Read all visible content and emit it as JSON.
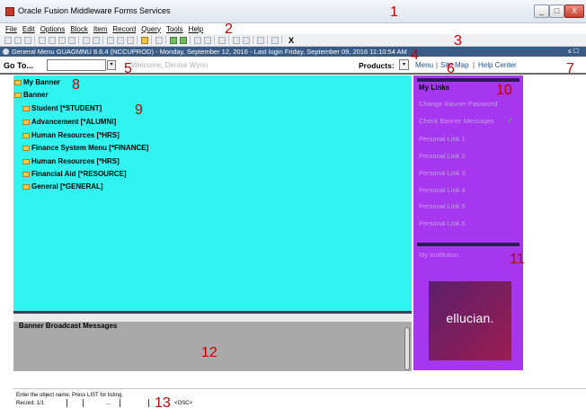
{
  "window": {
    "title": "Oracle Fusion Middleware Forms Services",
    "min": "_",
    "max": "□",
    "close": "X"
  },
  "menubar": [
    "File",
    "Edit",
    "Options",
    "Block",
    "Item",
    "Record",
    "Query",
    "Tools",
    "Help"
  ],
  "toolbar": {
    "exit_label": "X"
  },
  "form_title": "General Menu  GUAGMNU  8.6.4  (NCCUPROD) - Monday, September 12, 2016 - Last login Friday, September 09, 2016 11:10:54 AM",
  "form_controls": "≤ ☐",
  "goto": {
    "label": "Go To...",
    "value": "",
    "dropdown": "▾",
    "welcome": "Welcome, Denise Wynn"
  },
  "products": {
    "label": "Products:",
    "dropdown": "▾"
  },
  "top_links": [
    "Menu",
    "Site Map",
    "Help Center"
  ],
  "tree": {
    "my_banner": "My Banner",
    "banner": "Banner",
    "items": [
      "Student [*STUDENT]",
      "Advancement [*ALUMNI]",
      "Human Resources [*HRS]",
      "Finance System Menu [*FINANCE]",
      "Human Resources [*HRS]",
      "Financial Aid [*RESOURCE]",
      "General [*GENERAL]"
    ]
  },
  "my_links": {
    "heading": "My Links",
    "links": [
      "Change Banner Password",
      "Check Banner Messages",
      "Personal Link 1",
      "Personal Link 2",
      "Personal Link 3",
      "Personal Link 4",
      "Personal Link 5",
      "Personal Link 6"
    ],
    "check": "✔",
    "institution": "My Institution",
    "logo_text": "ellucian."
  },
  "broadcast": {
    "title": "Banner Broadcast Messages"
  },
  "status": {
    "hint": "Enter the object name; Press LIST for listing.",
    "record": "Record: 1/1",
    "record_field": "...",
    "osc": "<OSC>"
  },
  "annotations": [
    "1",
    "2",
    "3",
    "4",
    "5",
    "6",
    "7",
    "8",
    "9",
    "10",
    "11",
    "12",
    "13"
  ]
}
